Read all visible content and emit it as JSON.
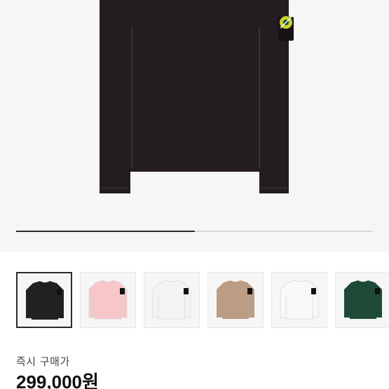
{
  "product": {
    "main_color": "#231d21",
    "badge_color": "#c9d12e"
  },
  "gallery": {
    "progress": 0.5
  },
  "thumbnails": [
    {
      "color": "#222022",
      "selected": true
    },
    {
      "color": "#f7c6c8",
      "selected": false
    },
    {
      "color": "#f3f3f1",
      "selected": false
    },
    {
      "color": "#bb9c84",
      "selected": false
    },
    {
      "color": "#f8f8f8",
      "selected": false
    },
    {
      "color": "#1f4a38",
      "selected": false
    }
  ],
  "pricing": {
    "label": "즉시 구매가",
    "value": "299,000원"
  }
}
